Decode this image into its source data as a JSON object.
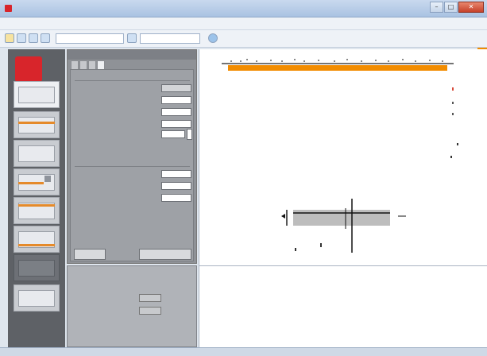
{
  "window": {
    "title": "",
    "minimize": "–",
    "maximize": "□",
    "close": "✕"
  },
  "menu": [
    {
      "label": ""
    },
    {
      "label": ""
    },
    {
      "label": ""
    },
    {
      "label": ""
    }
  ],
  "toolbar": {
    "combo1": "",
    "combo2": ""
  },
  "logo": "",
  "tabs": [
    {
      "label": ""
    },
    {
      "label": ""
    },
    {
      "label": ""
    },
    {
      "label": ""
    }
  ],
  "group1": {
    "title": "",
    "rows": [
      {
        "label": "",
        "sym": "",
        "value": ""
      },
      {
        "label": "",
        "sym": "",
        "value": ""
      },
      {
        "label": "",
        "sym": "",
        "value": ""
      },
      {
        "label": "",
        "sym": "",
        "value": ""
      },
      {
        "label": "",
        "sym": "",
        "value": ""
      }
    ]
  },
  "group2": {
    "title": "",
    "rows": [
      {
        "label": "",
        "sym": "",
        "value": ""
      },
      {
        "label": "",
        "sym": "",
        "value": ""
      },
      {
        "label": "",
        "sym": "",
        "value": ""
      }
    ]
  },
  "buttons": {
    "left": "",
    "right": ""
  },
  "results": {
    "title": "",
    "rows": [
      {
        "label": "",
        "sym": "",
        "value": ""
      },
      {
        "label": "",
        "sym": "",
        "value": ""
      }
    ]
  },
  "canvas": {
    "label": "",
    "axis_ticks": [
      "",
      "",
      ""
    ],
    "center_label": "",
    "section_label": "",
    "legend": [
      "",
      "",
      "",
      "",
      "",
      ""
    ]
  },
  "messages": {
    "title": "",
    "text": ""
  },
  "status": ""
}
